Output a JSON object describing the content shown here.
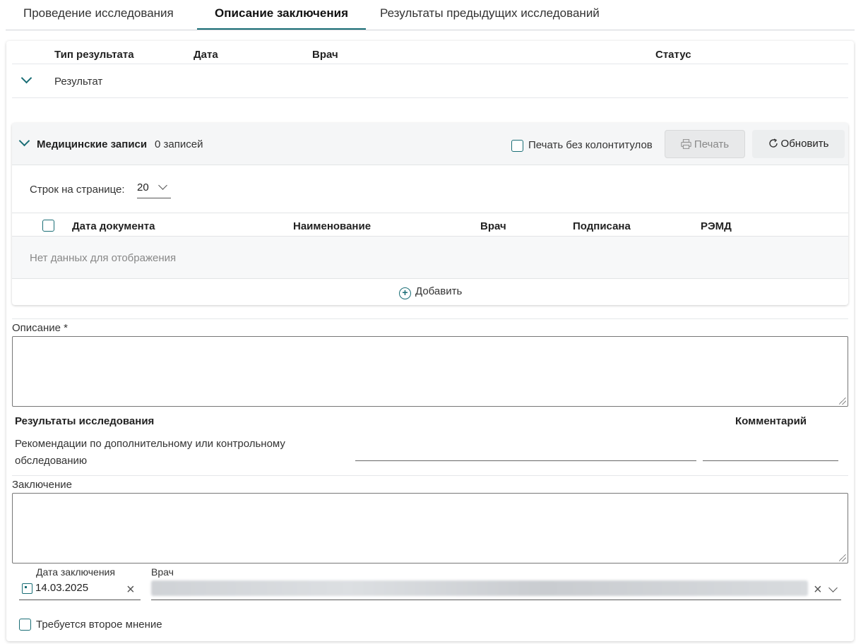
{
  "tabs": [
    {
      "label": "Проведение исследования",
      "active": false
    },
    {
      "label": "Описание заключения",
      "active": true
    },
    {
      "label": "Результаты предыдущих исследований",
      "active": false
    }
  ],
  "result_grid": {
    "columns": [
      "Тип результата",
      "Дата",
      "Врач",
      "Статус"
    ],
    "row_label": "Результат"
  },
  "medical_records": {
    "title": "Медицинские записи",
    "count": "0 записей",
    "print_without_headers": "Печать без колонтитулов",
    "print_label": "Печать",
    "refresh_label": "Обновить",
    "rows_per_page_label": "Строк на странице:",
    "rows_per_page_value": "20",
    "columns": [
      "Дата документа",
      "Наименование",
      "Врач",
      "Подписана",
      "РЭМД"
    ],
    "empty_text": "Нет данных для отображения",
    "add_label": "Добавить"
  },
  "description": {
    "label": "Описание *",
    "value": ""
  },
  "study_results": {
    "title": "Результаты исследования",
    "comment_header": "Комментарий",
    "recommendation_label_line1": "Рекомендации по дополнительному или контрольному",
    "recommendation_label_line2": "обследованию"
  },
  "conclusion": {
    "label": "Заключение",
    "value": ""
  },
  "conclusion_date": {
    "label": "Дата заключения",
    "value": "14.03.2025"
  },
  "doctor": {
    "label": "Врач"
  },
  "second_opinion": {
    "label": "Требуется второе мнение"
  },
  "colors": {
    "accent": "#1a6e76"
  }
}
